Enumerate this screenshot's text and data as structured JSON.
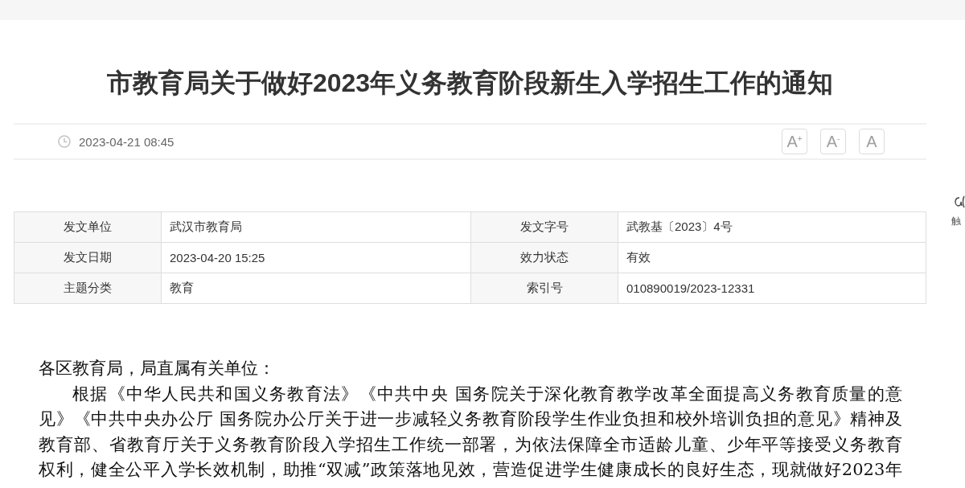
{
  "title": "市教育局关于做好2023年义务教育阶段新生入学招生工作的通知",
  "meta": {
    "date": "2023-04-21 08:45",
    "font_buttons": [
      {
        "label": "A$^{+}$"
      },
      {
        "label": "A$^{-}$"
      },
      {
        "label": "A"
      }
    ]
  },
  "info_table": {
    "rows": [
      [
        {
          "label": "发文单位",
          "value": "武汉市教育局"
        },
        {
          "label": "发文字号",
          "value": "武教基〔2023〕4号"
        }
      ],
      [
        {
          "label": "发文日期",
          "value": "2023-04-20 15:25"
        },
        {
          "label": "效力状态",
          "value": "有效"
        }
      ],
      [
        {
          "label": "主题分类",
          "value": "教育"
        },
        {
          "label": "索引号",
          "value": "010890019/2023-12331"
        }
      ]
    ]
  },
  "body": {
    "salutation": "各区教育局，局直属有关单位：",
    "paragraph_lines": [
      "根据《中华人民共和国义务教育法》《中共中央 国务院关于深化教育教学改革全面提高义务教育质量的意",
      "见》《中共中央办公厅 国务院办公厅关于进一步减轻义务教育阶段学生作业负担和校外培训负担的意见》精神及",
      "教育部、省教育厅关于义务教育阶段入学招生工作统一部署，为依法保障全市适龄儿童、少年平等接受义务教育",
      "权利，健全公平入学长效机制，助推“双减”政策落地见效，营造促进学生健康成长的良好生态，现就做好2023年"
    ]
  },
  "side_tool": {
    "label": "触"
  }
}
